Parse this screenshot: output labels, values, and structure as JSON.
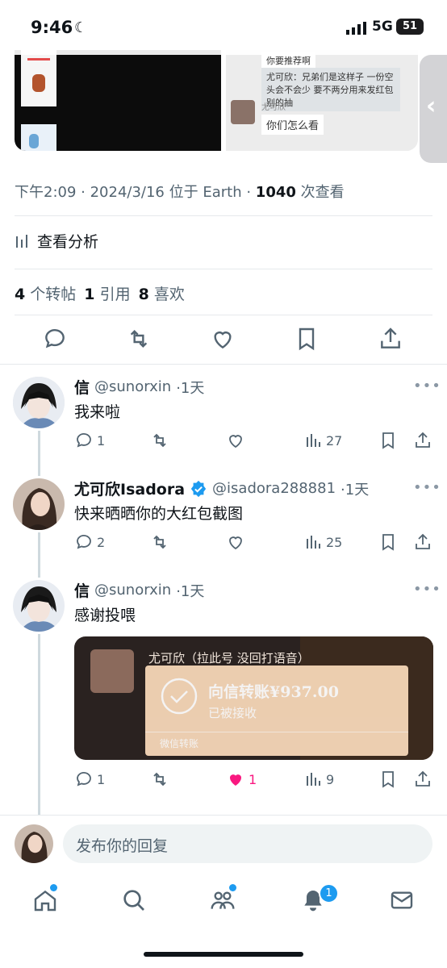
{
  "status_bar": {
    "time": "9:46",
    "network": "5G",
    "battery": "51"
  },
  "media": {
    "chat_line_1": "你要推荐啊",
    "chat_line_2": "尤可欣：兄弟们是这样子 一份空头会不会少 要不两分用来发红包 别的抽",
    "chat_name": "尤可欣",
    "chat_line_3": "你们怎么看"
  },
  "tweet_meta": {
    "time": "下午2:09",
    "date": "2024/3/16",
    "location": "位于 Earth",
    "views": "1040",
    "views_label": "次查看"
  },
  "analytics_label": "查看分析",
  "stats": {
    "retweets": "4",
    "retweets_label": "个转帖",
    "quotes": "1",
    "quotes_label": "引用",
    "likes": "8",
    "likes_label": "喜欢"
  },
  "replies": [
    {
      "name": "信",
      "handle": "@sunorxin",
      "age": "·1天",
      "text": "我来啦",
      "replies": "1",
      "retweets": "",
      "likes": "",
      "views": "27",
      "verified": false
    },
    {
      "name": "尤可欣Isadora",
      "handle": "@isadora288881",
      "age": "·1天",
      "text": "快来晒晒你的大红包截图",
      "replies": "2",
      "retweets": "",
      "likes": "",
      "views": "25",
      "verified": true
    },
    {
      "name": "信",
      "handle": "@sunorxin",
      "age": "·1天",
      "text": "感谢投喂",
      "replies": "1",
      "retweets": "",
      "likes": "1",
      "views": "9",
      "verified": false,
      "liked": true
    }
  ],
  "embed": {
    "header": "尤可欣（拉此号 没回打语音）",
    "amount": "向信转账¥937.00",
    "status": "已被接收",
    "footer": "微信转账"
  },
  "composer": {
    "placeholder": "发布你的回复"
  },
  "tabbar": {
    "notifications_badge": "1"
  },
  "colors": {
    "accent": "#1d9bf0",
    "like": "#f91880",
    "verified": "#1d9bf0"
  }
}
